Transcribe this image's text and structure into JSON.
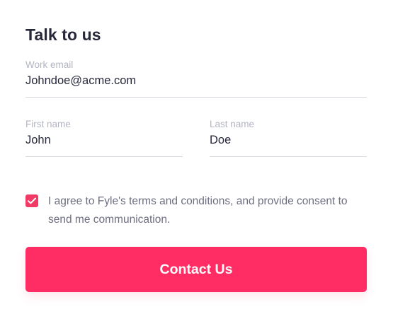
{
  "form": {
    "title": "Talk to us",
    "email": {
      "label": "Work email",
      "value": "Johndoe@acme.com"
    },
    "first_name": {
      "label": "First name",
      "value": "John"
    },
    "last_name": {
      "label": "Last name",
      "value": "Doe"
    },
    "consent": {
      "checked": true,
      "text": "I agree to Fyle's terms and conditions, and provide consent to send me communication."
    },
    "submit_label": "Contact Us"
  },
  "colors": {
    "accent": "#ff2d63",
    "checkbox": "#f23a66",
    "title": "#27283a",
    "label": "#b3b5c2",
    "divider": "#d8d9df"
  },
  "icons": {
    "checkbox": "checkmark-icon"
  }
}
